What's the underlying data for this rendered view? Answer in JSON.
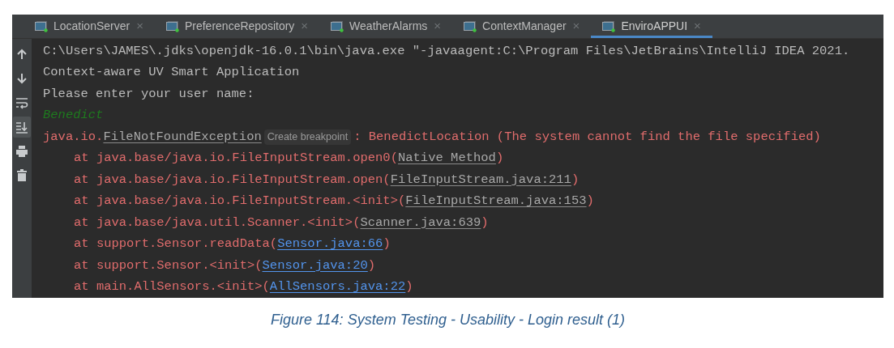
{
  "tabs": [
    {
      "label": "LocationServer",
      "close": "×",
      "selected": false
    },
    {
      "label": "PreferenceRepository",
      "close": "×",
      "selected": false
    },
    {
      "label": "WeatherAlarms",
      "close": "×",
      "selected": false
    },
    {
      "label": "ContextManager",
      "close": "×",
      "selected": false
    },
    {
      "label": "EnviroAPPUI",
      "close": "×",
      "selected": true
    }
  ],
  "toolbar": [
    {
      "kind": "up",
      "selected": false
    },
    {
      "kind": "down",
      "selected": false
    },
    {
      "kind": "wrap",
      "selected": false
    },
    {
      "kind": "scroll-end",
      "selected": true
    },
    {
      "kind": "print",
      "selected": false
    },
    {
      "kind": "trash",
      "selected": false
    }
  ],
  "console": [
    {
      "segments": [
        {
          "kind": "output",
          "text": "C:\\Users\\JAMES\\.jdks\\openjdk-16.0.1\\bin\\java.exe \"-javaagent:C:\\Program Files\\JetBrains\\IntelliJ IDEA 2021."
        }
      ]
    },
    {
      "segments": [
        {
          "kind": "output",
          "text": "Context-aware UV Smart Application"
        }
      ]
    },
    {
      "segments": [
        {
          "kind": "output",
          "text": "Please enter your user name:"
        }
      ]
    },
    {
      "segments": [
        {
          "kind": "input",
          "text": "Benedict"
        }
      ]
    },
    {
      "segments": [
        {
          "kind": "error",
          "text": "java.io."
        },
        {
          "kind": "class-link",
          "text": "FileNotFoundException"
        },
        {
          "kind": "hint",
          "text": "Create breakpoint"
        },
        {
          "kind": "error",
          "text": ": BenedictLocation (The system cannot find the file specified)"
        }
      ],
      "children": [
        {
          "segments": [
            {
              "kind": "error",
              "text": "at java.base/java.io.FileInputStream.open0("
            },
            {
              "kind": "class-link",
              "text": "Native Method"
            },
            {
              "kind": "error",
              "text": ")"
            }
          ]
        },
        {
          "segments": [
            {
              "kind": "error",
              "text": "at java.base/java.io.FileInputStream.open("
            },
            {
              "kind": "class-link",
              "text": "FileInputStream.java:211"
            },
            {
              "kind": "error",
              "text": ")"
            }
          ]
        },
        {
          "segments": [
            {
              "kind": "error",
              "text": "at java.base/java.io.FileInputStream.<init>("
            },
            {
              "kind": "class-link",
              "text": "FileInputStream.java:153"
            },
            {
              "kind": "error",
              "text": ")"
            }
          ]
        },
        {
          "segments": [
            {
              "kind": "error",
              "text": "at java.base/java.util.Scanner.<init>("
            },
            {
              "kind": "class-link",
              "text": "Scanner.java:639"
            },
            {
              "kind": "error",
              "text": ")"
            }
          ]
        },
        {
          "segments": [
            {
              "kind": "error",
              "text": "at support.Sensor.readData("
            },
            {
              "kind": "source-link",
              "text": "Sensor.java:66"
            },
            {
              "kind": "error",
              "text": ")"
            }
          ]
        },
        {
          "segments": [
            {
              "kind": "error",
              "text": "at support.Sensor.<init>("
            },
            {
              "kind": "source-link",
              "text": "Sensor.java:20"
            },
            {
              "kind": "error",
              "text": ")"
            }
          ]
        },
        {
          "segments": [
            {
              "kind": "error",
              "text": "at main.AllSensors.<init>("
            },
            {
              "kind": "source-link",
              "text": "AllSensors.java:22"
            },
            {
              "kind": "error",
              "text": ")"
            }
          ]
        }
      ]
    }
  ],
  "caption": "Figure 114: System Testing - Usability - Login result (1)"
}
